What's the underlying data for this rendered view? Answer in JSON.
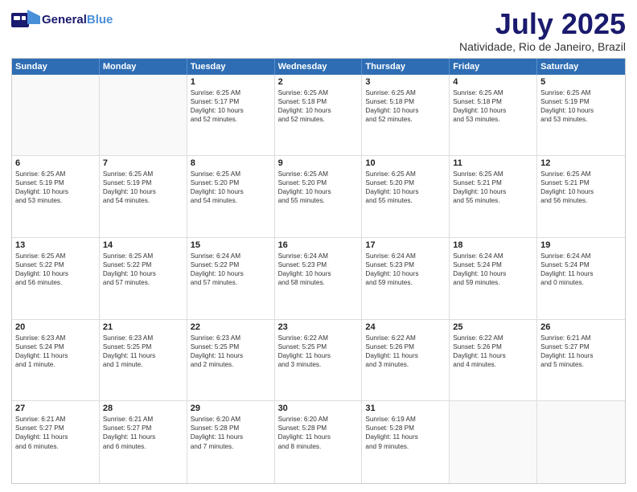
{
  "header": {
    "logo_general": "General",
    "logo_blue": "Blue",
    "month_title": "July 2025",
    "location": "Natividade, Rio de Janeiro, Brazil"
  },
  "weekdays": [
    "Sunday",
    "Monday",
    "Tuesday",
    "Wednesday",
    "Thursday",
    "Friday",
    "Saturday"
  ],
  "rows": [
    [
      {
        "day": "",
        "lines": []
      },
      {
        "day": "",
        "lines": []
      },
      {
        "day": "1",
        "lines": [
          "Sunrise: 6:25 AM",
          "Sunset: 5:17 PM",
          "Daylight: 10 hours",
          "and 52 minutes."
        ]
      },
      {
        "day": "2",
        "lines": [
          "Sunrise: 6:25 AM",
          "Sunset: 5:18 PM",
          "Daylight: 10 hours",
          "and 52 minutes."
        ]
      },
      {
        "day": "3",
        "lines": [
          "Sunrise: 6:25 AM",
          "Sunset: 5:18 PM",
          "Daylight: 10 hours",
          "and 52 minutes."
        ]
      },
      {
        "day": "4",
        "lines": [
          "Sunrise: 6:25 AM",
          "Sunset: 5:18 PM",
          "Daylight: 10 hours",
          "and 53 minutes."
        ]
      },
      {
        "day": "5",
        "lines": [
          "Sunrise: 6:25 AM",
          "Sunset: 5:19 PM",
          "Daylight: 10 hours",
          "and 53 minutes."
        ]
      }
    ],
    [
      {
        "day": "6",
        "lines": [
          "Sunrise: 6:25 AM",
          "Sunset: 5:19 PM",
          "Daylight: 10 hours",
          "and 53 minutes."
        ]
      },
      {
        "day": "7",
        "lines": [
          "Sunrise: 6:25 AM",
          "Sunset: 5:19 PM",
          "Daylight: 10 hours",
          "and 54 minutes."
        ]
      },
      {
        "day": "8",
        "lines": [
          "Sunrise: 6:25 AM",
          "Sunset: 5:20 PM",
          "Daylight: 10 hours",
          "and 54 minutes."
        ]
      },
      {
        "day": "9",
        "lines": [
          "Sunrise: 6:25 AM",
          "Sunset: 5:20 PM",
          "Daylight: 10 hours",
          "and 55 minutes."
        ]
      },
      {
        "day": "10",
        "lines": [
          "Sunrise: 6:25 AM",
          "Sunset: 5:20 PM",
          "Daylight: 10 hours",
          "and 55 minutes."
        ]
      },
      {
        "day": "11",
        "lines": [
          "Sunrise: 6:25 AM",
          "Sunset: 5:21 PM",
          "Daylight: 10 hours",
          "and 55 minutes."
        ]
      },
      {
        "day": "12",
        "lines": [
          "Sunrise: 6:25 AM",
          "Sunset: 5:21 PM",
          "Daylight: 10 hours",
          "and 56 minutes."
        ]
      }
    ],
    [
      {
        "day": "13",
        "lines": [
          "Sunrise: 6:25 AM",
          "Sunset: 5:22 PM",
          "Daylight: 10 hours",
          "and 56 minutes."
        ]
      },
      {
        "day": "14",
        "lines": [
          "Sunrise: 6:25 AM",
          "Sunset: 5:22 PM",
          "Daylight: 10 hours",
          "and 57 minutes."
        ]
      },
      {
        "day": "15",
        "lines": [
          "Sunrise: 6:24 AM",
          "Sunset: 5:22 PM",
          "Daylight: 10 hours",
          "and 57 minutes."
        ]
      },
      {
        "day": "16",
        "lines": [
          "Sunrise: 6:24 AM",
          "Sunset: 5:23 PM",
          "Daylight: 10 hours",
          "and 58 minutes."
        ]
      },
      {
        "day": "17",
        "lines": [
          "Sunrise: 6:24 AM",
          "Sunset: 5:23 PM",
          "Daylight: 10 hours",
          "and 59 minutes."
        ]
      },
      {
        "day": "18",
        "lines": [
          "Sunrise: 6:24 AM",
          "Sunset: 5:24 PM",
          "Daylight: 10 hours",
          "and 59 minutes."
        ]
      },
      {
        "day": "19",
        "lines": [
          "Sunrise: 6:24 AM",
          "Sunset: 5:24 PM",
          "Daylight: 11 hours",
          "and 0 minutes."
        ]
      }
    ],
    [
      {
        "day": "20",
        "lines": [
          "Sunrise: 6:23 AM",
          "Sunset: 5:24 PM",
          "Daylight: 11 hours",
          "and 1 minute."
        ]
      },
      {
        "day": "21",
        "lines": [
          "Sunrise: 6:23 AM",
          "Sunset: 5:25 PM",
          "Daylight: 11 hours",
          "and 1 minute."
        ]
      },
      {
        "day": "22",
        "lines": [
          "Sunrise: 6:23 AM",
          "Sunset: 5:25 PM",
          "Daylight: 11 hours",
          "and 2 minutes."
        ]
      },
      {
        "day": "23",
        "lines": [
          "Sunrise: 6:22 AM",
          "Sunset: 5:25 PM",
          "Daylight: 11 hours",
          "and 3 minutes."
        ]
      },
      {
        "day": "24",
        "lines": [
          "Sunrise: 6:22 AM",
          "Sunset: 5:26 PM",
          "Daylight: 11 hours",
          "and 3 minutes."
        ]
      },
      {
        "day": "25",
        "lines": [
          "Sunrise: 6:22 AM",
          "Sunset: 5:26 PM",
          "Daylight: 11 hours",
          "and 4 minutes."
        ]
      },
      {
        "day": "26",
        "lines": [
          "Sunrise: 6:21 AM",
          "Sunset: 5:27 PM",
          "Daylight: 11 hours",
          "and 5 minutes."
        ]
      }
    ],
    [
      {
        "day": "27",
        "lines": [
          "Sunrise: 6:21 AM",
          "Sunset: 5:27 PM",
          "Daylight: 11 hours",
          "and 6 minutes."
        ]
      },
      {
        "day": "28",
        "lines": [
          "Sunrise: 6:21 AM",
          "Sunset: 5:27 PM",
          "Daylight: 11 hours",
          "and 6 minutes."
        ]
      },
      {
        "day": "29",
        "lines": [
          "Sunrise: 6:20 AM",
          "Sunset: 5:28 PM",
          "Daylight: 11 hours",
          "and 7 minutes."
        ]
      },
      {
        "day": "30",
        "lines": [
          "Sunrise: 6:20 AM",
          "Sunset: 5:28 PM",
          "Daylight: 11 hours",
          "and 8 minutes."
        ]
      },
      {
        "day": "31",
        "lines": [
          "Sunrise: 6:19 AM",
          "Sunset: 5:28 PM",
          "Daylight: 11 hours",
          "and 9 minutes."
        ]
      },
      {
        "day": "",
        "lines": []
      },
      {
        "day": "",
        "lines": []
      }
    ]
  ]
}
